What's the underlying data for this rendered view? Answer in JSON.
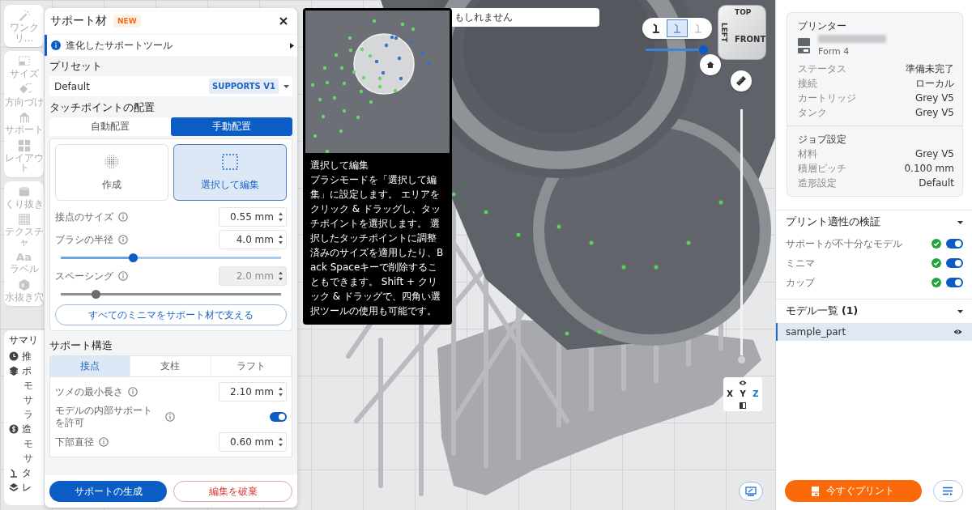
{
  "toolbar": {
    "groups": [
      {
        "items": [
          {
            "kind": "wand",
            "label": "ワンクリ…"
          }
        ]
      },
      {
        "items": [
          {
            "kind": "size",
            "label": "サイズ"
          },
          {
            "kind": "orient",
            "label": "方向づけ"
          },
          {
            "kind": "support",
            "label": "サポート"
          },
          {
            "kind": "layout",
            "label": "レイアウト"
          }
        ]
      },
      {
        "items": [
          {
            "kind": "hollow",
            "label": "くり抜き"
          },
          {
            "kind": "texture",
            "label": "テクスチャ"
          },
          {
            "kind": "label",
            "glyph": "Aa",
            "label": "ラベル"
          },
          {
            "kind": "drain",
            "label": "水抜き穴"
          }
        ]
      }
    ]
  },
  "summary": {
    "title": "サマリ",
    "items": [
      {
        "kind": "clock",
        "label": "推"
      },
      {
        "kind": "cubes",
        "label": "ポ",
        "children": [
          {
            "label": "モ"
          },
          {
            "label": "サ"
          },
          {
            "label": "ラ"
          }
        ]
      },
      {
        "kind": "dollar",
        "label": "造",
        "children": [
          {
            "label": "モ"
          },
          {
            "label": "サ"
          }
        ]
      },
      {
        "kind": "touch",
        "label": "タ"
      },
      {
        "kind": "layers",
        "label": "レ"
      }
    ]
  },
  "notice": {
    "text": "もしれません"
  },
  "panel": {
    "title": "サポート材",
    "badge": "NEW",
    "info": "進化したサポートツール",
    "preset": {
      "label": "プリセット",
      "value": "Default",
      "tag": "SUPPORTS V1"
    },
    "placement": {
      "label": "タッチポイントの配置",
      "options": [
        {
          "label": "自動配置",
          "selected": false
        },
        {
          "label": "手動配置",
          "selected": true
        }
      ],
      "modes": [
        {
          "kind": "create",
          "label": "作成",
          "selected": false
        },
        {
          "kind": "select",
          "label": "選択して編集",
          "selected": true
        }
      ],
      "settings": [
        {
          "kind": "number",
          "label": "接点のサイズ",
          "value": "0.55 mm",
          "disabled": false
        },
        {
          "kind": "number",
          "label": "ブラシの半径",
          "value": "4.0 mm",
          "disabled": false
        },
        {
          "kind": "slider",
          "level": 0.33,
          "disabled": false
        },
        {
          "kind": "number",
          "label": "スペーシング",
          "value": "2.0 mm",
          "disabled": true
        },
        {
          "kind": "slider",
          "level": 0.16,
          "disabled": true
        }
      ],
      "action": "すべてのミニマをサポート材で支える"
    },
    "structure": {
      "label": "サポート構造",
      "tabs": [
        {
          "label": "接点",
          "selected": true
        },
        {
          "label": "支柱",
          "selected": false
        },
        {
          "label": "ラフト",
          "selected": false
        }
      ],
      "settings": [
        {
          "kind": "number",
          "label": "ツメの最小長さ",
          "value": "2.10 mm",
          "disabled": false
        },
        {
          "kind": "toggle",
          "label": "モデルの内部サポートを許可",
          "on": true
        },
        {
          "kind": "number",
          "label": "下部直径",
          "value": "0.60 mm",
          "disabled": false
        }
      ]
    },
    "buttons": [
      {
        "kind": "primary",
        "label": "サポートの生成"
      },
      {
        "kind": "danger",
        "label": "編集を破棄"
      }
    ]
  },
  "tooltip": {
    "title": "選択して編集",
    "body": "ブラシモードを「選択して編集」に設定します。 エリアをクリック & ドラッグし、タッチポイントを選択します。 選択したタッチポイントに調整済みのサイズを適用したり、Back Spaceキーで削除することもできます。 Shift + クリック & ドラッグで、四角い選択ツールの使用も可能です。"
  },
  "viewport": {
    "support_modes": [
      {
        "selected": false
      },
      {
        "selected": true
      },
      {
        "selected": false
      }
    ],
    "support_slider": {
      "level": 1
    },
    "cube": {
      "top": "TOP",
      "left": "LEFT",
      "front": "FRONT"
    },
    "layer_slider": {
      "level": 0
    },
    "axes": [
      {
        "label": "X",
        "selected": false
      },
      {
        "label": "Y",
        "selected": false
      },
      {
        "label": "Z",
        "selected": true
      }
    ]
  },
  "printer": {
    "title": "プリンター",
    "model": "Form 4",
    "rows": [
      {
        "label": "ステータス",
        "value": "準備未完了"
      },
      {
        "label": "接続",
        "value": "ローカル"
      },
      {
        "label": "カートリッジ",
        "value": "Grey V5"
      },
      {
        "label": "タンク",
        "value": "Grey V5"
      }
    ]
  },
  "job": {
    "title": "ジョブ設定",
    "rows": [
      {
        "label": "材料",
        "value": "Grey V5"
      },
      {
        "label": "積層ピッチ",
        "value": "0.100 mm"
      },
      {
        "label": "造形設定",
        "value": "Default"
      }
    ]
  },
  "checks": {
    "title": "プリント適性の検証",
    "expanded": true,
    "items": [
      {
        "label": "サポートが不十分なモデル",
        "passed": true,
        "on": true
      },
      {
        "label": "ミニマ",
        "passed": true,
        "on": true
      },
      {
        "label": "カップ",
        "passed": true,
        "on": true
      }
    ]
  },
  "models": {
    "title": "モデル一覧 **(1)**",
    "expanded": true,
    "items": [
      {
        "name": "sample_part",
        "selected": true,
        "visible": true
      }
    ]
  },
  "print_button": {
    "label": "今すぐプリント"
  }
}
